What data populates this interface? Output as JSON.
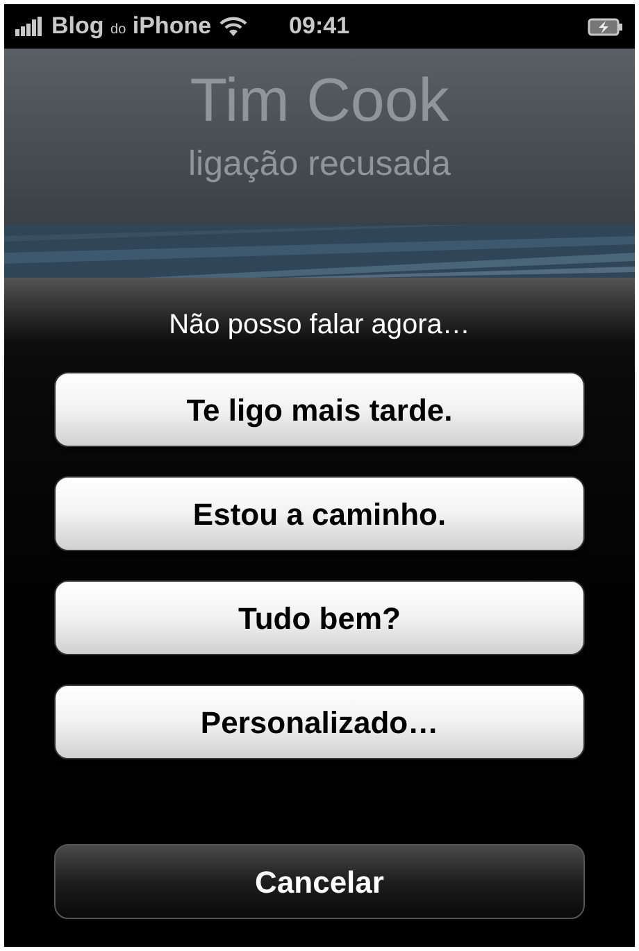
{
  "status_bar": {
    "carrier": "Blog",
    "carrier_small": "do",
    "carrier_suffix": "iPhone",
    "time": "09:41"
  },
  "caller": {
    "name": "Tim Cook",
    "status": "ligação recusada"
  },
  "sheet": {
    "title": "Não posso falar agora…",
    "buttons": [
      {
        "label": "Te ligo mais tarde.",
        "kind": "reply"
      },
      {
        "label": "Estou a caminho.",
        "kind": "reply"
      },
      {
        "label": "Tudo bem?",
        "kind": "reply"
      },
      {
        "label": "Personalizado…",
        "kind": "reply"
      },
      {
        "label": "Cancelar",
        "kind": "cancel"
      }
    ]
  }
}
